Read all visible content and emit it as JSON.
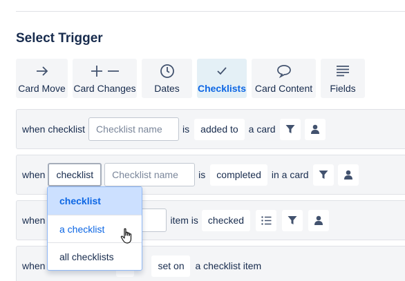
{
  "section_title": "Select Trigger",
  "tabs": [
    {
      "label": "Card Move",
      "icon": "arrow-right-icon"
    },
    {
      "label": "Card Changes",
      "icon": "plus-minus-icon"
    },
    {
      "label": "Dates",
      "icon": "clock-icon"
    },
    {
      "label": "Checklists",
      "icon": "check-icon",
      "selected": true
    },
    {
      "label": "Card Content",
      "icon": "speech-bubble-icon"
    },
    {
      "label": "Fields",
      "icon": "fields-icon"
    }
  ],
  "rows": {
    "row1": {
      "when": "when checklist",
      "name_placeholder": "Checklist name",
      "is": "is",
      "action": "added to",
      "target": "a card"
    },
    "row2": {
      "when": "when",
      "scope": "checklist",
      "name_placeholder": "Checklist name",
      "is": "is",
      "action": "completed",
      "target": "in a card"
    },
    "row3": {
      "when": "when",
      "item_is": "item is",
      "state": "checked"
    },
    "row4": {
      "when": "when",
      "set_on": "set on",
      "target": "a checklist item"
    }
  },
  "dropdown": {
    "options": [
      "checklist",
      "a checklist",
      "all checklists"
    ],
    "selected": "checklist"
  },
  "colors": {
    "accent": "#0c66e4",
    "selected_tab_bg": "#e4f0f6",
    "row_bg": "#f4f5f7"
  }
}
